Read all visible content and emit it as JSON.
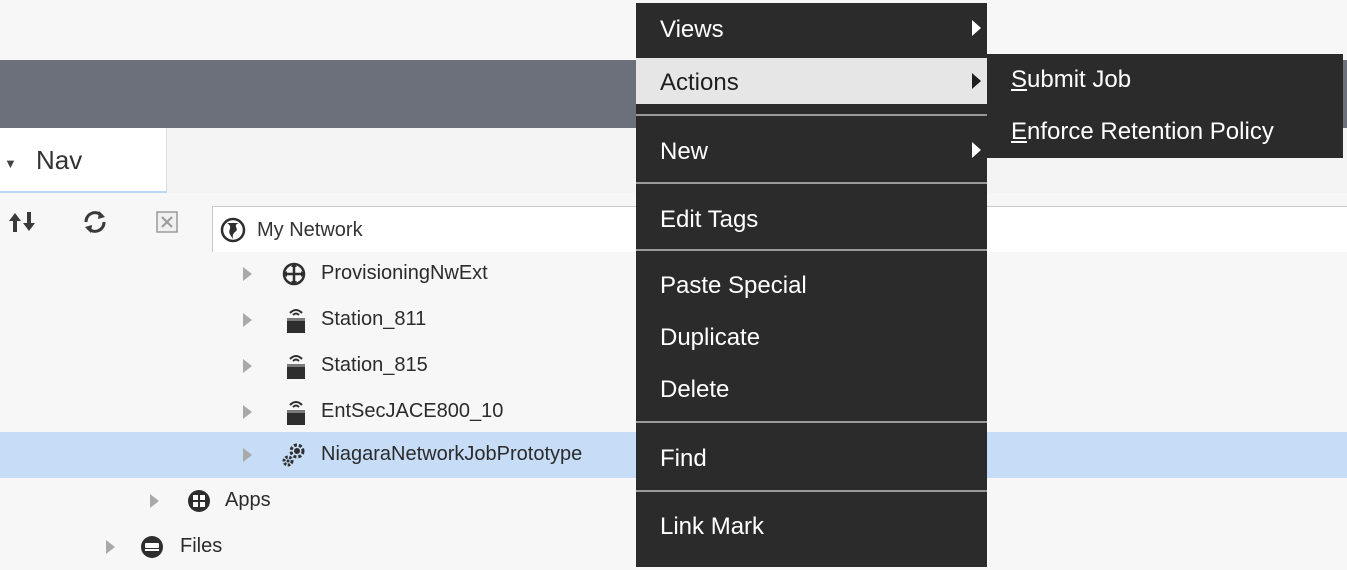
{
  "nav": {
    "tab_label": "Nav"
  },
  "toolbar": {
    "path": "My Network"
  },
  "tree": {
    "items": [
      {
        "label": "ProvisioningNwExt",
        "icon": "provisioning-icon"
      },
      {
        "label": "Station_811",
        "icon": "station-icon"
      },
      {
        "label": "Station_815",
        "icon": "station-icon"
      },
      {
        "label": "EntSecJACE800_10",
        "icon": "station-icon"
      },
      {
        "label": "NiagaraNetworkJobPrototype",
        "icon": "gears-icon",
        "selected": true
      },
      {
        "label": "Apps",
        "icon": "apps-icon"
      },
      {
        "label": "Files",
        "icon": "files-icon"
      }
    ]
  },
  "context_menu": {
    "items": [
      {
        "label": "Views",
        "submenu": true
      },
      {
        "label": "Actions",
        "submenu": true,
        "highlighted": true
      },
      {
        "label": "New",
        "submenu": true
      },
      {
        "label": "Edit Tags"
      },
      {
        "label": "Paste Special"
      },
      {
        "label": "Duplicate"
      },
      {
        "label": "Delete"
      },
      {
        "label": "Find"
      },
      {
        "label": "Link Mark"
      }
    ]
  },
  "submenu": {
    "items": [
      {
        "mnemonic": "S",
        "rest": "ubmit Job"
      },
      {
        "mnemonic": "E",
        "rest": "nforce Retention Policy"
      }
    ]
  },
  "colors": {
    "header": "#6c707a",
    "menu_bg": "#2b2b2b",
    "selection": "#c6dcf7"
  }
}
